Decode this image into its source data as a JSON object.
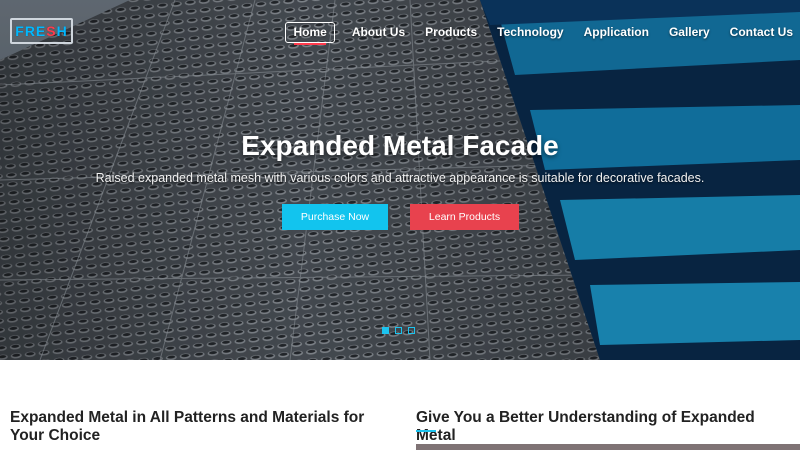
{
  "header": {
    "logo": {
      "text_main": "FRE",
      "text_accent": "S",
      "text_end": "H"
    },
    "nav": [
      {
        "label": "Home",
        "active": true
      },
      {
        "label": "About Us"
      },
      {
        "label": "Products"
      },
      {
        "label": "Technology"
      },
      {
        "label": "Application"
      },
      {
        "label": "Gallery"
      },
      {
        "label": "Contact Us"
      }
    ]
  },
  "hero": {
    "title": "Expanded Metal Facade",
    "subtitle": "Raised expanded metal mesh with various colors and attractive appearance is suitable for decorative facades.",
    "purchase_label": "Purchase Now",
    "learn_label": "Learn Products",
    "slides_total": 3,
    "slide_active": 1
  },
  "sections": {
    "left_heading": "Expanded Metal in All Patterns and Materials for Your Choice",
    "right_heading": "Give You a Better Understanding of Expanded Metal"
  },
  "colors": {
    "accent": "#1cc3ef",
    "red": "#e8424e"
  }
}
